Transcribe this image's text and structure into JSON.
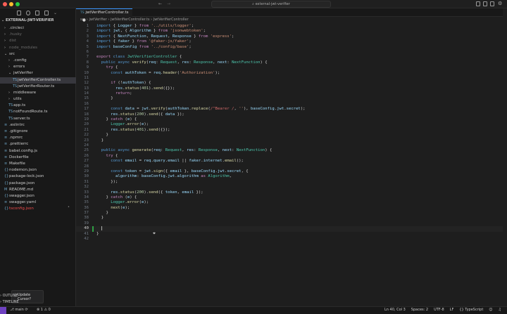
{
  "window": {
    "title": "external-jwt-verifier",
    "colors": {
      "close": "#ff5f57",
      "min": "#febc2e",
      "max": "#28c840",
      "accent": "#3794ff"
    }
  },
  "explorer": {
    "project": "EXTERNAL-JWT-VERIFIER",
    "items": [
      {
        "label": ".circleci",
        "kind": "folder",
        "depth": 1,
        "state": ""
      },
      {
        "label": ".husky",
        "kind": "folder",
        "depth": 1,
        "state": "dim"
      },
      {
        "label": "dist",
        "kind": "folder",
        "depth": 1,
        "state": "dim"
      },
      {
        "label": "node_modules",
        "kind": "folder",
        "depth": 1,
        "state": "dim"
      },
      {
        "label": "src",
        "kind": "folder-open",
        "depth": 1,
        "state": ""
      },
      {
        "label": ".config",
        "kind": "folder",
        "depth": 2,
        "state": ""
      },
      {
        "label": "errors",
        "kind": "folder",
        "depth": 2,
        "state": ""
      },
      {
        "label": "jwtVerifier",
        "kind": "folder-open",
        "depth": 2,
        "state": ""
      },
      {
        "label": "jwtVerifierController.ts",
        "kind": "ts",
        "depth": 3,
        "state": "sel"
      },
      {
        "label": "jwtVerifierRouter.ts",
        "kind": "ts",
        "depth": 3,
        "state": ""
      },
      {
        "label": "middleware",
        "kind": "folder",
        "depth": 2,
        "state": ""
      },
      {
        "label": "utils",
        "kind": "folder",
        "depth": 2,
        "state": ""
      },
      {
        "label": "app.ts",
        "kind": "ts",
        "depth": 2,
        "state": ""
      },
      {
        "label": "notFoundRoute.ts",
        "kind": "ts",
        "depth": 2,
        "state": ""
      },
      {
        "label": "server.ts",
        "kind": "ts",
        "depth": 2,
        "state": ""
      },
      {
        "label": ".eslintrc",
        "kind": "file",
        "depth": 1,
        "state": ""
      },
      {
        "label": ".gitignore",
        "kind": "file",
        "depth": 1,
        "state": ""
      },
      {
        "label": ".npmrc",
        "kind": "file",
        "depth": 1,
        "state": ""
      },
      {
        "label": ".prettierrc",
        "kind": "file",
        "depth": 1,
        "state": ""
      },
      {
        "label": "babel.config.js",
        "kind": "file",
        "depth": 1,
        "state": ""
      },
      {
        "label": "Dockerfile",
        "kind": "file",
        "depth": 1,
        "state": ""
      },
      {
        "label": "Makefile",
        "kind": "file",
        "depth": 1,
        "state": ""
      },
      {
        "label": "nodemon.json",
        "kind": "json",
        "depth": 1,
        "state": ""
      },
      {
        "label": "package-lock.json",
        "kind": "json",
        "depth": 1,
        "state": ""
      },
      {
        "label": "package.json",
        "kind": "json",
        "depth": 1,
        "state": ""
      },
      {
        "label": "README.md",
        "kind": "md",
        "depth": 1,
        "state": ""
      },
      {
        "label": "swagger.json",
        "kind": "json",
        "depth": 1,
        "state": ""
      },
      {
        "label": "swagger.yaml",
        "kind": "file",
        "depth": 1,
        "state": ""
      },
      {
        "label": "tsconfig.json",
        "kind": "json",
        "depth": 1,
        "state": "err"
      }
    ],
    "panels": [
      "OUTLINE",
      "TIMELINE"
    ]
  },
  "notification": {
    "title": "Update Cursor?"
  },
  "editor": {
    "tab": "jwtVerifierController.ts",
    "tab_prefix": "TS",
    "breadcrumb": [
      "src",
      "jwtVerifier",
      "jwtVerifierController.ts",
      "JwtVerifierController"
    ],
    "current_line": 40,
    "lines": [
      [
        [
          "k",
          "import "
        ],
        [
          "p",
          "{ "
        ],
        [
          "v",
          "Logger"
        ],
        [
          "p",
          " } "
        ],
        [
          "c",
          "from "
        ],
        [
          "s",
          "'../utils/logger'"
        ],
        [
          "p",
          ";"
        ]
      ],
      [
        [
          "k",
          "import "
        ],
        [
          "v",
          "jwt"
        ],
        [
          "p",
          ", { "
        ],
        [
          "v",
          "Algorithm"
        ],
        [
          "p",
          " } "
        ],
        [
          "c",
          "from "
        ],
        [
          "s",
          "'jsonwebtoken'"
        ],
        [
          "p",
          ";"
        ]
      ],
      [
        [
          "k",
          "import "
        ],
        [
          "p",
          "{ "
        ],
        [
          "v",
          "NextFunction"
        ],
        [
          "p",
          ", "
        ],
        [
          "v",
          "Request"
        ],
        [
          "p",
          ", "
        ],
        [
          "v",
          "Response"
        ],
        [
          "p",
          " } "
        ],
        [
          "c",
          "from "
        ],
        [
          "s",
          "'express'"
        ],
        [
          "p",
          ";"
        ]
      ],
      [
        [
          "k",
          "import "
        ],
        [
          "p",
          "{ "
        ],
        [
          "v",
          "faker"
        ],
        [
          "p",
          " } "
        ],
        [
          "c",
          "from "
        ],
        [
          "s",
          "'@faker-js/faker'"
        ],
        [
          "p",
          ";"
        ]
      ],
      [
        [
          "k",
          "import "
        ],
        [
          "v",
          "baseConfig "
        ],
        [
          "c",
          "from "
        ],
        [
          "s",
          "'../config/base'"
        ],
        [
          "p",
          ";"
        ]
      ],
      [],
      [
        [
          "c",
          "export "
        ],
        [
          "k",
          "class "
        ],
        [
          "t",
          "JwtVerifierController"
        ],
        [
          "p",
          " {"
        ]
      ],
      [
        [
          "p",
          "  "
        ],
        [
          "k",
          "public async "
        ],
        [
          "f",
          "verify"
        ],
        [
          "p",
          "("
        ],
        [
          "v",
          "req"
        ],
        [
          "p",
          ": "
        ],
        [
          "t",
          "Request"
        ],
        [
          "p",
          ", "
        ],
        [
          "v",
          "res"
        ],
        [
          "p",
          ": "
        ],
        [
          "t",
          "Response"
        ],
        [
          "p",
          ", "
        ],
        [
          "v",
          "next"
        ],
        [
          "p",
          ": "
        ],
        [
          "t",
          "NextFunction"
        ],
        [
          "p",
          ") {"
        ]
      ],
      [
        [
          "p",
          "    "
        ],
        [
          "c",
          "try "
        ],
        [
          "p",
          "{"
        ]
      ],
      [
        [
          "p",
          "      "
        ],
        [
          "k",
          "const "
        ],
        [
          "v",
          "authToken"
        ],
        [
          "p",
          " = "
        ],
        [
          "v",
          "req"
        ],
        [
          "p",
          "."
        ],
        [
          "f",
          "header"
        ],
        [
          "p",
          "("
        ],
        [
          "s",
          "'Authorization'"
        ],
        [
          "p",
          ");"
        ]
      ],
      [],
      [
        [
          "p",
          "      "
        ],
        [
          "c",
          "if "
        ],
        [
          "p",
          "(!"
        ],
        [
          "v",
          "authToken"
        ],
        [
          "p",
          ") {"
        ]
      ],
      [
        [
          "p",
          "        "
        ],
        [
          "v",
          "res"
        ],
        [
          "p",
          "."
        ],
        [
          "f",
          "status"
        ],
        [
          "p",
          "("
        ],
        [
          "n",
          "401"
        ],
        [
          "p",
          ")."
        ],
        [
          "f",
          "send"
        ],
        [
          "p",
          "({});"
        ]
      ],
      [
        [
          "p",
          "        "
        ],
        [
          "c",
          "return"
        ],
        [
          "p",
          ";"
        ]
      ],
      [
        [
          "p",
          "      }"
        ]
      ],
      [],
      [
        [
          "p",
          "      "
        ],
        [
          "k",
          "const "
        ],
        [
          "v",
          "data"
        ],
        [
          "p",
          " = "
        ],
        [
          "v",
          "jwt"
        ],
        [
          "p",
          "."
        ],
        [
          "f",
          "verify"
        ],
        [
          "p",
          "("
        ],
        [
          "v",
          "authToken"
        ],
        [
          "p",
          "."
        ],
        [
          "f",
          "replace"
        ],
        [
          "p",
          "("
        ],
        [
          "r",
          "/^Bearer /"
        ],
        [
          "p",
          ", "
        ],
        [
          "s",
          "''"
        ],
        [
          "p",
          "), "
        ],
        [
          "v",
          "baseConfig"
        ],
        [
          "p",
          "."
        ],
        [
          "v",
          "jwt"
        ],
        [
          "p",
          "."
        ],
        [
          "v",
          "secret"
        ],
        [
          "p",
          ");"
        ]
      ],
      [
        [
          "p",
          "      "
        ],
        [
          "v",
          "res"
        ],
        [
          "p",
          "."
        ],
        [
          "f",
          "status"
        ],
        [
          "p",
          "("
        ],
        [
          "n",
          "200"
        ],
        [
          "p",
          ")."
        ],
        [
          "f",
          "send"
        ],
        [
          "p",
          "({ "
        ],
        [
          "v",
          "data"
        ],
        [
          "p",
          " });"
        ]
      ],
      [
        [
          "p",
          "    } "
        ],
        [
          "c",
          "catch "
        ],
        [
          "p",
          "("
        ],
        [
          "v",
          "e"
        ],
        [
          "p",
          ") {"
        ]
      ],
      [
        [
          "p",
          "      "
        ],
        [
          "t",
          "Logger"
        ],
        [
          "p",
          "."
        ],
        [
          "f",
          "error"
        ],
        [
          "p",
          "("
        ],
        [
          "v",
          "e"
        ],
        [
          "p",
          ");"
        ]
      ],
      [
        [
          "p",
          "      "
        ],
        [
          "v",
          "res"
        ],
        [
          "p",
          "."
        ],
        [
          "f",
          "status"
        ],
        [
          "p",
          "("
        ],
        [
          "n",
          "401"
        ],
        [
          "p",
          ")."
        ],
        [
          "f",
          "send"
        ],
        [
          "p",
          "({});"
        ]
      ],
      [
        [
          "p",
          "    }"
        ]
      ],
      [
        [
          "p",
          "  }"
        ]
      ],
      [],
      [
        [
          "p",
          "  "
        ],
        [
          "k",
          "public async "
        ],
        [
          "f",
          "generate"
        ],
        [
          "p",
          "("
        ],
        [
          "v",
          "req"
        ],
        [
          "p",
          ": "
        ],
        [
          "t",
          "Request"
        ],
        [
          "p",
          ", "
        ],
        [
          "v",
          "res"
        ],
        [
          "p",
          ": "
        ],
        [
          "t",
          "Response"
        ],
        [
          "p",
          ", "
        ],
        [
          "v",
          "next"
        ],
        [
          "p",
          ": "
        ],
        [
          "t",
          "NextFunction"
        ],
        [
          "p",
          ") {"
        ]
      ],
      [
        [
          "p",
          "    "
        ],
        [
          "c",
          "try "
        ],
        [
          "p",
          "{"
        ]
      ],
      [
        [
          "p",
          "      "
        ],
        [
          "k",
          "const "
        ],
        [
          "v",
          "email"
        ],
        [
          "p",
          " = "
        ],
        [
          "v",
          "req"
        ],
        [
          "p",
          "."
        ],
        [
          "v",
          "query"
        ],
        [
          "p",
          "."
        ],
        [
          "v",
          "email"
        ],
        [
          "p",
          " || "
        ],
        [
          "v",
          "faker"
        ],
        [
          "p",
          "."
        ],
        [
          "v",
          "internet"
        ],
        [
          "p",
          "."
        ],
        [
          "f",
          "email"
        ],
        [
          "p",
          "();"
        ]
      ],
      [],
      [
        [
          "p",
          "      "
        ],
        [
          "k",
          "const "
        ],
        [
          "v",
          "token"
        ],
        [
          "p",
          " = "
        ],
        [
          "v",
          "jwt"
        ],
        [
          "p",
          "."
        ],
        [
          "f",
          "sign"
        ],
        [
          "p",
          "({ "
        ],
        [
          "v",
          "email"
        ],
        [
          "p",
          " }, "
        ],
        [
          "v",
          "baseConfig"
        ],
        [
          "p",
          "."
        ],
        [
          "v",
          "jwt"
        ],
        [
          "p",
          "."
        ],
        [
          "v",
          "secret"
        ],
        [
          "p",
          ", {"
        ]
      ],
      [
        [
          "p",
          "        "
        ],
        [
          "v",
          "algorithm"
        ],
        [
          "p",
          ": "
        ],
        [
          "v",
          "baseConfig"
        ],
        [
          "p",
          "."
        ],
        [
          "v",
          "jwt"
        ],
        [
          "p",
          "."
        ],
        [
          "v",
          "algorithm"
        ],
        [
          "c",
          " as "
        ],
        [
          "t",
          "Algorithm"
        ],
        [
          "p",
          ","
        ]
      ],
      [
        [
          "p",
          "      });"
        ]
      ],
      [],
      [
        [
          "p",
          "      "
        ],
        [
          "v",
          "res"
        ],
        [
          "p",
          "."
        ],
        [
          "f",
          "status"
        ],
        [
          "p",
          "("
        ],
        [
          "n",
          "200"
        ],
        [
          "p",
          ")."
        ],
        [
          "f",
          "send"
        ],
        [
          "p",
          "({ "
        ],
        [
          "v",
          "token"
        ],
        [
          "p",
          ", "
        ],
        [
          "v",
          "email"
        ],
        [
          "p",
          " });"
        ]
      ],
      [
        [
          "p",
          "    } "
        ],
        [
          "c",
          "catch "
        ],
        [
          "p",
          "("
        ],
        [
          "v",
          "e"
        ],
        [
          "p",
          ") {"
        ]
      ],
      [
        [
          "p",
          "      "
        ],
        [
          "t",
          "Logger"
        ],
        [
          "p",
          "."
        ],
        [
          "f",
          "error"
        ],
        [
          "p",
          "("
        ],
        [
          "v",
          "e"
        ],
        [
          "p",
          ");"
        ]
      ],
      [
        [
          "p",
          "      "
        ],
        [
          "f",
          "next"
        ],
        [
          "p",
          "("
        ],
        [
          "v",
          "e"
        ],
        [
          "p",
          ");"
        ]
      ],
      [
        [
          "p",
          "    }"
        ]
      ],
      [
        [
          "p",
          "  }"
        ]
      ],
      [],
      [
        [
          "p",
          "  "
        ]
      ],
      [
        [
          "p",
          "}"
        ]
      ],
      []
    ]
  },
  "statusbar": {
    "branch": "main",
    "sync": "⟳",
    "errors": "⊗ 1",
    "warnings": "⚠ 0",
    "position": "Ln 40, Col 3",
    "spaces": "Spaces: 2",
    "encoding": "UTF-8",
    "eol": "LF",
    "language": "{} TypeScript"
  }
}
